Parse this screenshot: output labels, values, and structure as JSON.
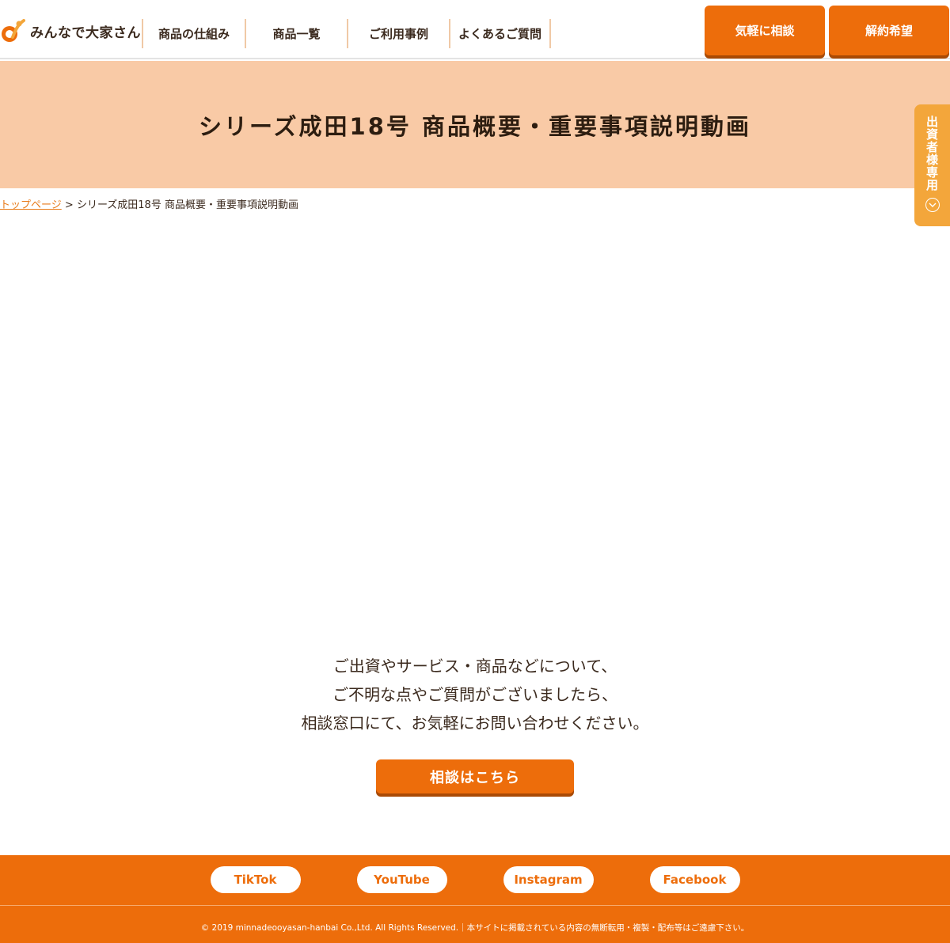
{
  "header": {
    "logo_text": "みんなで大家さん",
    "nav": [
      "商品の仕組み",
      "商品一覧",
      "ご利用事例",
      "よくあるご質問"
    ],
    "buttons": [
      "気軽に相談",
      "解約希望"
    ]
  },
  "hero": {
    "title": "シリーズ成田18号 商品概要・重要事項説明動画"
  },
  "side_tab": {
    "label": "出資者様専用",
    "icon": "chevron-down-circle-icon"
  },
  "breadcrumb": {
    "home": "トップページ",
    "separator": ">",
    "current": "シリーズ成田18号 商品概要・重要事項説明動画"
  },
  "contact": {
    "lines": [
      "ご出資やサービス・商品などについて、",
      "ご不明な点やご質問がございましたら、",
      "相談窓口にて、お気軽にお問い合わせください。"
    ],
    "cta": "相談はこちら"
  },
  "footer": {
    "social": [
      "TikTok",
      "YouTube",
      "Instagram",
      "Facebook"
    ],
    "copyright": "© 2019 minnadeooyasan-hanbai Co.,Ltd. All Rights Reserved.｜本サイトに掲載されている内容の無断転用・複製・配布等はご遠慮下さい。"
  },
  "colors": {
    "brand_orange": "#ed6d0b",
    "hero_bg": "#f9caa6",
    "side_tab": "#f3a63b",
    "text": "#3b2a1e"
  }
}
